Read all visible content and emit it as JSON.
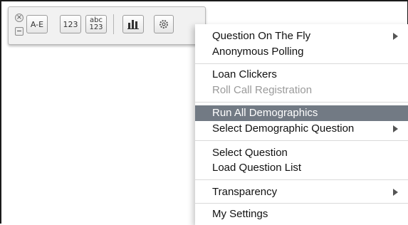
{
  "toolbar": {
    "ae_label": "A-E",
    "numeric_label": "123",
    "alnum_line1": "abc",
    "alnum_line2": "123",
    "close_glyph": "×"
  },
  "menu": {
    "items": [
      {
        "label": "Question On The Fly",
        "enabled": true,
        "submenu": true
      },
      {
        "label": "Anonymous Polling",
        "enabled": true,
        "submenu": false
      },
      {
        "label": "Loan Clickers",
        "enabled": true,
        "submenu": false
      },
      {
        "label": "Roll Call Registration",
        "enabled": false,
        "submenu": false
      },
      {
        "label": "Run All Demographics",
        "enabled": true,
        "submenu": false,
        "highlighted": true
      },
      {
        "label": "Select Demographic Question",
        "enabled": true,
        "submenu": true
      },
      {
        "label": "Select Question",
        "enabled": true,
        "submenu": false
      },
      {
        "label": "Load Question List",
        "enabled": true,
        "submenu": false
      },
      {
        "label": "Transparency",
        "enabled": true,
        "submenu": true
      },
      {
        "label": "My Settings",
        "enabled": true,
        "submenu": false
      }
    ],
    "highlight_color": "#727a84",
    "disabled_color": "#9a9a9a"
  }
}
